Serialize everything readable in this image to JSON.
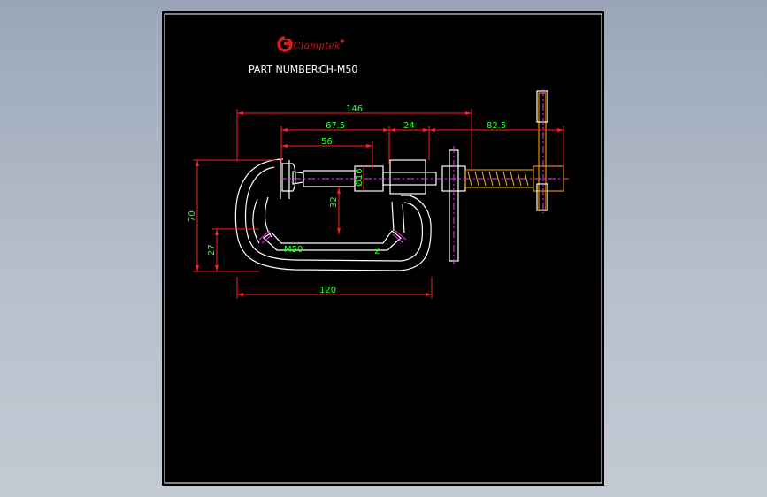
{
  "colors": {
    "background": "#a9b3c1",
    "sheet": "#000000",
    "border": "#ffffff",
    "outline": "#ffffff",
    "dimension": "#ff2020",
    "dimension_text": "#2bff2b",
    "centerline": "#ff2bff",
    "screw": "#ffb000",
    "brand": "#e01a1a"
  },
  "header": {
    "brand_name": "Clamptek",
    "part_number_label": "PART NUMBER:",
    "part_number": "CH-M50"
  },
  "dimensions": {
    "overall_length": "146",
    "screw_reach": "67.5",
    "jaw_depth": "56",
    "boss_length": "24",
    "handle_extension": "82.5",
    "frame_width": "120",
    "overall_height": "70",
    "lower_height": "27",
    "throat_depth": "32",
    "diameter": "Ø16"
  },
  "frame_markings": {
    "model": "M50",
    "number": "2"
  }
}
